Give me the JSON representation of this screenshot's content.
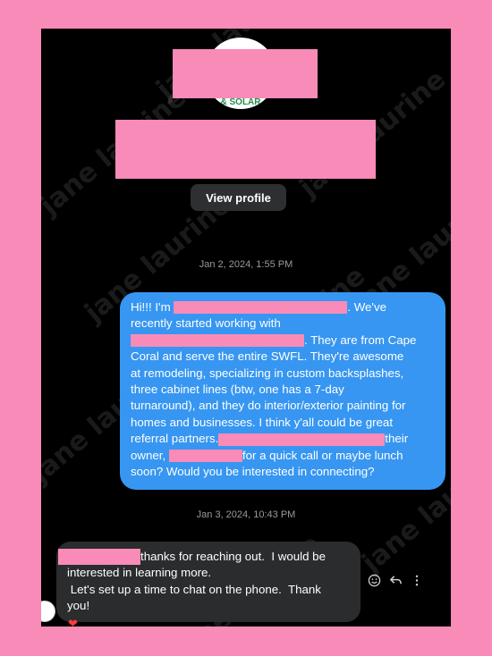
{
  "profile": {
    "logo_text": "& SOLAR",
    "view_profile_label": "View profile"
  },
  "thread": {
    "timestamp_1": "Jan 2, 2024, 1:55 PM",
    "timestamp_2": "Jan 3, 2024, 10:43 PM"
  },
  "outgoing_message": {
    "line1_start": "Hi!!! I'm ",
    "line1_end": ". We've",
    "line2": "recently started working with",
    "line3_end": ". They are from Cape",
    "line4": "Coral and serve the entire SWFL. They're awesome",
    "line5": "at remodeling, specializing in custom backsplashes,",
    "line6": "three cabinet lines (btw, one has a 7-day",
    "line7": "turnaround), and they do interior/exterior painting for",
    "line8": "homes and businesses. I think y'all could be great",
    "line9_start": "referral partners.",
    "line9_end": "their",
    "line10_start": "owner, ",
    "line10_end": "for a quick call or maybe lunch",
    "line11": "soon? Would you be interested in connecting?"
  },
  "incoming_message": {
    "line1_end": "thanks for reaching out.  I would be",
    "line2": "interested in learning more.",
    "line3": " Let's set up a time to chat on the phone.  Thank",
    "line4": "you!"
  },
  "reaction": {
    "emoji": "❤"
  },
  "watermark_text": "jane laurine",
  "colors": {
    "outgoing_bubble": "#3796f1",
    "incoming_bubble": "#2b2c2e",
    "redaction": "#f98bb8"
  }
}
